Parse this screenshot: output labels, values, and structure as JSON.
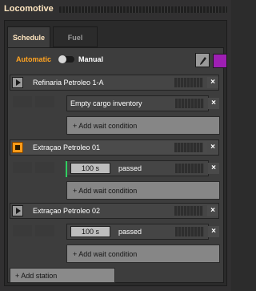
{
  "window": {
    "title": "Locomotive"
  },
  "tabs": [
    {
      "label": "Schedule"
    },
    {
      "label": "Fuel"
    }
  ],
  "mode": {
    "automatic_label": "Automatic",
    "manual_label": "Manual"
  },
  "colors": {
    "accent": "#ffa321",
    "title": "#ffe6c0",
    "swatch": "#9e1fb3",
    "active_stop": "#ff9a18"
  },
  "stations": [
    {
      "name": "Refinaria Petroleo 1-A",
      "active": false,
      "conditions": [
        {
          "text": "Empty cargo inventory"
        }
      ],
      "add_condition_label": "+ Add wait condition"
    },
    {
      "name": "Extraçao Petroleo 01",
      "active": true,
      "conditions": [
        {
          "value": "100 s",
          "text": "passed"
        }
      ],
      "add_condition_label": "+ Add wait condition"
    },
    {
      "name": "Extraçao Petroleo 02",
      "active": false,
      "conditions": [
        {
          "value": "100 s",
          "text": "passed"
        }
      ],
      "add_condition_label": "+ Add wait condition"
    }
  ],
  "add_station_label": "+ Add station",
  "close_glyph": "×",
  "icons": {
    "edit": "pencil-icon",
    "play": "play-icon",
    "stop": "stop-icon"
  }
}
